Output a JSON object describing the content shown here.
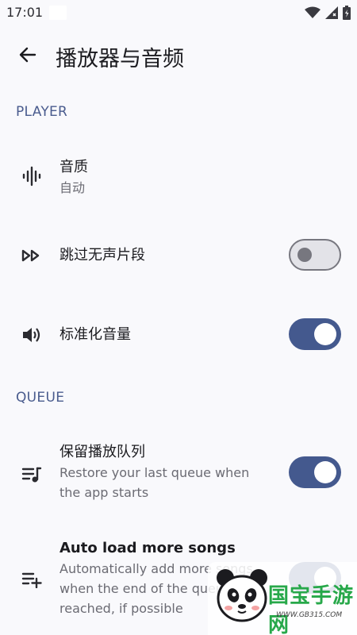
{
  "status_bar": {
    "time": "17:01",
    "icons": [
      "wifi-icon",
      "signal-icon",
      "battery-icon"
    ]
  },
  "app_bar": {
    "back_icon": "arrow-back-icon",
    "title": "播放器与音频"
  },
  "sections": {
    "player": {
      "header": "PLAYER",
      "quality": {
        "icon": "graphic-eq-icon",
        "title": "音质",
        "summary": "自动"
      },
      "skip_silence": {
        "icon": "fast-forward-icon",
        "title": "跳过无声片段",
        "enabled": false
      },
      "normalize": {
        "icon": "volume-up-icon",
        "title": "标准化音量",
        "enabled": true
      }
    },
    "queue": {
      "header": "QUEUE",
      "persistent": {
        "icon": "queue-music-icon",
        "title": "保留播放队列",
        "summary": "Restore your last queue when the app starts",
        "enabled": true
      },
      "autoload": {
        "icon": "playlist-add-icon",
        "title": "Auto load more songs",
        "summary": "Automatically add more songs when the end of the queue is reached, if possible",
        "enabled": true
      }
    }
  },
  "watermark": {
    "text": "国宝手游网",
    "url": "WWW.GB315.COM"
  },
  "colors": {
    "accent": "#44598e",
    "section_header": "#4a5c8e",
    "background": "#f9f9fc",
    "watermark": "#27a84a"
  }
}
